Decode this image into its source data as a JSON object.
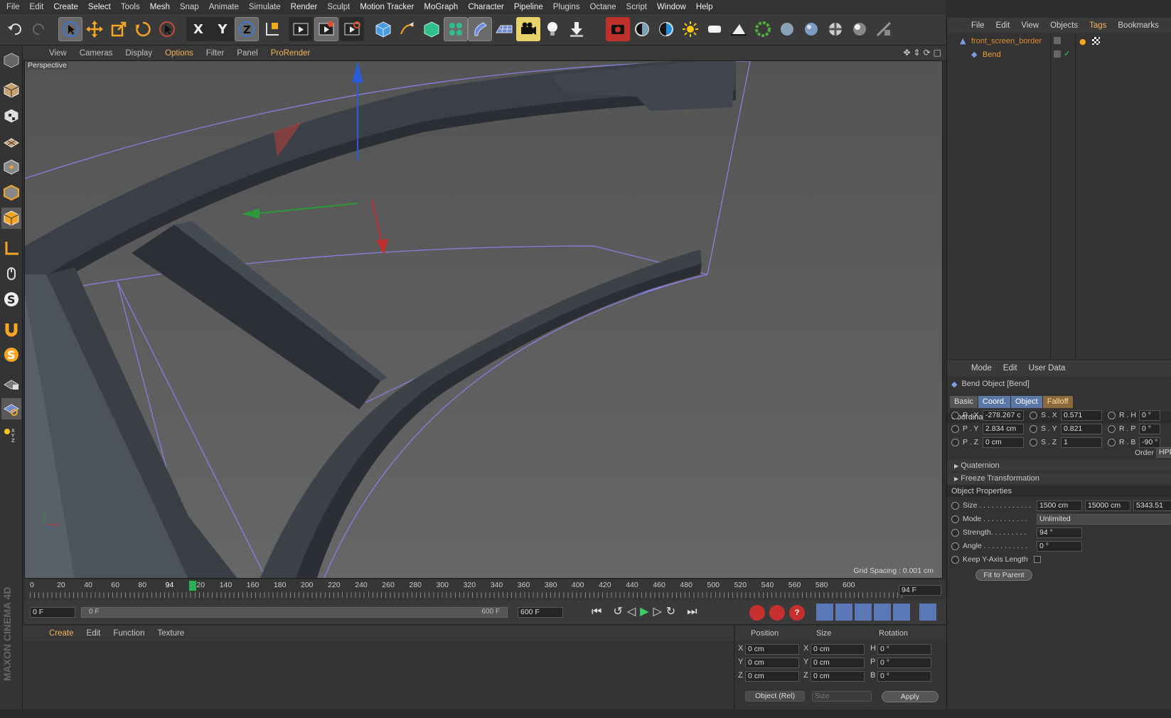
{
  "menu": [
    "File",
    "Edit",
    "Create",
    "Select",
    "Tools",
    "Mesh",
    "Snap",
    "Animate",
    "Simulate",
    "Render",
    "Sculpt",
    "Motion Tracker",
    "MoGraph",
    "Character",
    "Pipeline",
    "Plugins",
    "Octane",
    "Script",
    "Window",
    "Help"
  ],
  "viewport": {
    "menu": [
      "View",
      "Cameras",
      "Display",
      "Options",
      "Filter",
      "Panel",
      "ProRender"
    ],
    "active_menu": "Options",
    "label": "Perspective",
    "grid_spacing": "Grid Spacing : 0.001 cm"
  },
  "timeline": {
    "ticks": [
      "0",
      "20",
      "40",
      "60",
      "80",
      "94",
      "120",
      "140",
      "160",
      "180",
      "200",
      "220",
      "240",
      "260",
      "280",
      "300",
      "320",
      "340",
      "360",
      "380",
      "400",
      "420",
      "440",
      "460",
      "480",
      "500",
      "520",
      "540",
      "560",
      "580",
      "600"
    ],
    "current_frame": "94",
    "current_frame_field": "94 F",
    "start_field": "0 F",
    "range_start": "0 F",
    "range_end": "600 F",
    "end_field": "600 F"
  },
  "material_manager": {
    "menu": [
      "Create",
      "Edit",
      "Function",
      "Texture"
    ],
    "brand": "MAXON CINEMA 4D"
  },
  "coord_manager": {
    "headers": [
      "Position",
      "Size",
      "Rotation"
    ],
    "rows": [
      {
        "axis": "X",
        "pos": "0 cm",
        "saxis": "X",
        "size": "0 cm",
        "raxis": "H",
        "rot": "0 °"
      },
      {
        "axis": "Y",
        "pos": "0 cm",
        "saxis": "Y",
        "size": "0 cm",
        "raxis": "P",
        "rot": "0 °"
      },
      {
        "axis": "Z",
        "pos": "0 cm",
        "saxis": "Z",
        "size": "0 cm",
        "raxis": "B",
        "rot": "0 °"
      }
    ],
    "mode": "Object (Rel)",
    "size_mode": "Size",
    "apply": "Apply"
  },
  "object_manager": {
    "menu": [
      "File",
      "Edit",
      "View",
      "Objects",
      "Tags",
      "Bookmarks"
    ],
    "objects": [
      {
        "name": "front_screen_border",
        "color": "#e08a2c"
      },
      {
        "name": "Bend",
        "color": "#f0a030"
      }
    ]
  },
  "attribute_manager": {
    "menu": [
      "Mode",
      "Edit",
      "User Data"
    ],
    "title": "Bend Object [Bend]",
    "tabs": [
      "Basic",
      "Coord.",
      "Object",
      "Falloff"
    ],
    "coordinates_label": "Coordinates",
    "coords": [
      {
        "p": "P . X",
        "pv": "-278.267 c",
        "s": "S . X",
        "sv": "0.571",
        "r": "R . H",
        "rv": "0 °"
      },
      {
        "p": "P . Y",
        "pv": "2.834 cm",
        "s": "S . Y",
        "sv": "0.821",
        "r": "R . P",
        "rv": "0 °"
      },
      {
        "p": "P . Z",
        "pv": "0 cm",
        "s": "S . Z",
        "sv": "1",
        "r": "R . B",
        "rv": "-90 °"
      }
    ],
    "order_label": "Order",
    "order_value": "HPB",
    "quaternion": "Quaternion",
    "freeze": "Freeze Transformation",
    "object_props_label": "Object Properties",
    "size_label": "Size . . . . . . . . . . . . .",
    "size_values": [
      "1500 cm",
      "15000 cm",
      "5343.51"
    ],
    "mode_label": "Mode . . . . . . . . . . .",
    "mode_value": "Unlimited",
    "strength_label": "Strength. . . . . . . . .",
    "strength_value": "94 °",
    "angle_label": "Angle . . . . . . . . . . .",
    "angle_value": "0 °",
    "keep_y_label": "Keep Y-Axis Length",
    "fit_button": "Fit to Parent"
  }
}
